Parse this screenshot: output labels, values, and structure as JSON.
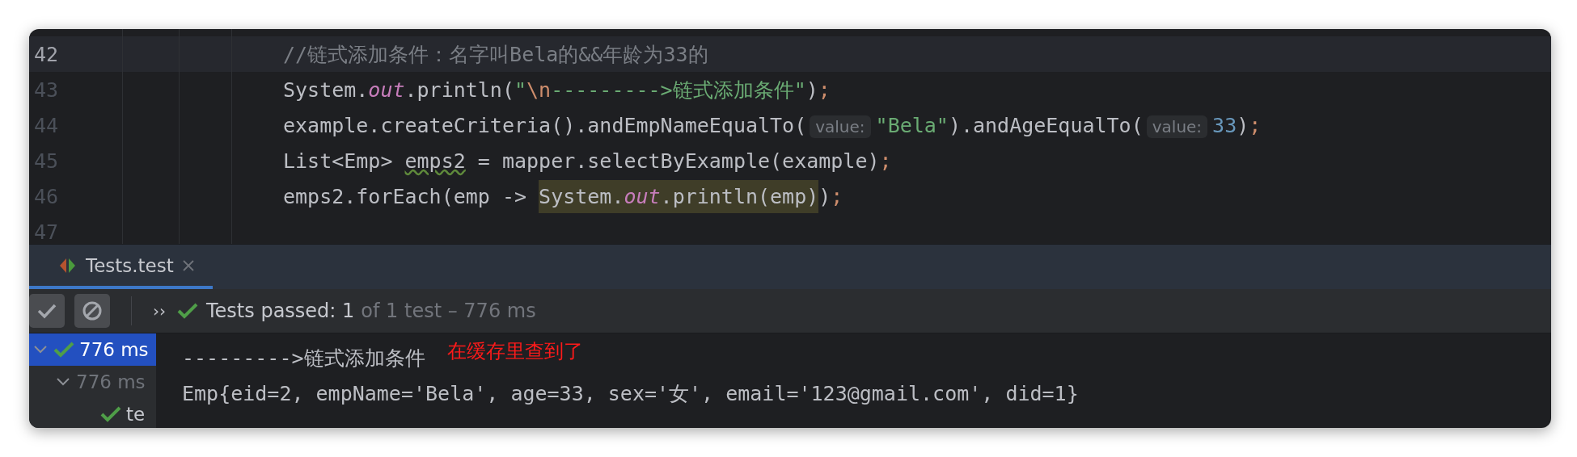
{
  "editor": {
    "lines": [
      {
        "number": "42",
        "current": true,
        "tokens": [
          {
            "kind": "comment",
            "text": "//链式添加条件：名字叫Bela的&&年龄为33的"
          }
        ]
      },
      {
        "number": "43",
        "current": false,
        "tokens": [
          {
            "kind": "plain",
            "text": "System."
          },
          {
            "kind": "field",
            "text": "out"
          },
          {
            "kind": "plain",
            "text": ".println("
          },
          {
            "kind": "string",
            "text": "\""
          },
          {
            "kind": "keyword",
            "text": "\\n"
          },
          {
            "kind": "string",
            "text": "--------->链式添加条件\""
          },
          {
            "kind": "plain",
            "text": ")"
          },
          {
            "kind": "keyword",
            "text": ";"
          }
        ]
      },
      {
        "number": "44",
        "current": false,
        "tokens": [
          {
            "kind": "plain",
            "text": "example.createCriteria().andEmpNameEqualTo("
          },
          {
            "kind": "hint",
            "text": "value:"
          },
          {
            "kind": "string",
            "text": "\"Bela\""
          },
          {
            "kind": "plain",
            "text": ").andAgeEqualTo("
          },
          {
            "kind": "hint",
            "text": "value:"
          },
          {
            "kind": "number",
            "text": "33"
          },
          {
            "kind": "plain",
            "text": ")"
          },
          {
            "kind": "keyword",
            "text": ";"
          }
        ]
      },
      {
        "number": "45",
        "current": false,
        "tokens": [
          {
            "kind": "plain",
            "text": "List<Emp> "
          },
          {
            "kind": "warning",
            "text": "emps2"
          },
          {
            "kind": "plain",
            "text": " = mapper.selectByExample(example)"
          },
          {
            "kind": "keyword",
            "text": ";"
          }
        ]
      },
      {
        "number": "46",
        "current": false,
        "tokens": [
          {
            "kind": "plain",
            "text": "emps2.forEach(emp -> "
          },
          {
            "kind": "highlight",
            "children": [
              {
                "kind": "plain",
                "text": "System."
              },
              {
                "kind": "field",
                "text": "out"
              },
              {
                "kind": "plain",
                "text": ".println(emp)"
              }
            ]
          },
          {
            "kind": "plain",
            "text": ")"
          },
          {
            "kind": "keyword",
            "text": ";"
          }
        ]
      },
      {
        "number": "47",
        "current": false
      }
    ]
  },
  "run_tabs": [
    {
      "label": "Tests.test",
      "selected": true
    }
  ],
  "toolbar": {
    "buttons": [
      {
        "kind": "check",
        "on": true
      },
      {
        "kind": "stop",
        "on": true
      }
    ],
    "more": "››",
    "status": "Tests passed: 1",
    "detail": "of 1 test – 776 ms"
  },
  "test_tree": [
    {
      "label": "776 ms",
      "passed": true,
      "selected": true,
      "expanded": true,
      "children": [
        {
          "label": "776 ms",
          "passed": false,
          "selected": false,
          "expanded": true,
          "children": [
            {
              "label": "te",
              "passed": true,
              "selected": false
            }
          ]
        }
      ]
    }
  ],
  "console": {
    "lines": [
      "--------->链式添加条件",
      "Emp{eid=2, empName='Bela', age=33, sex='女', email='123@gmail.com', did=1}"
    ]
  },
  "annotation": "在缓存里查到了"
}
